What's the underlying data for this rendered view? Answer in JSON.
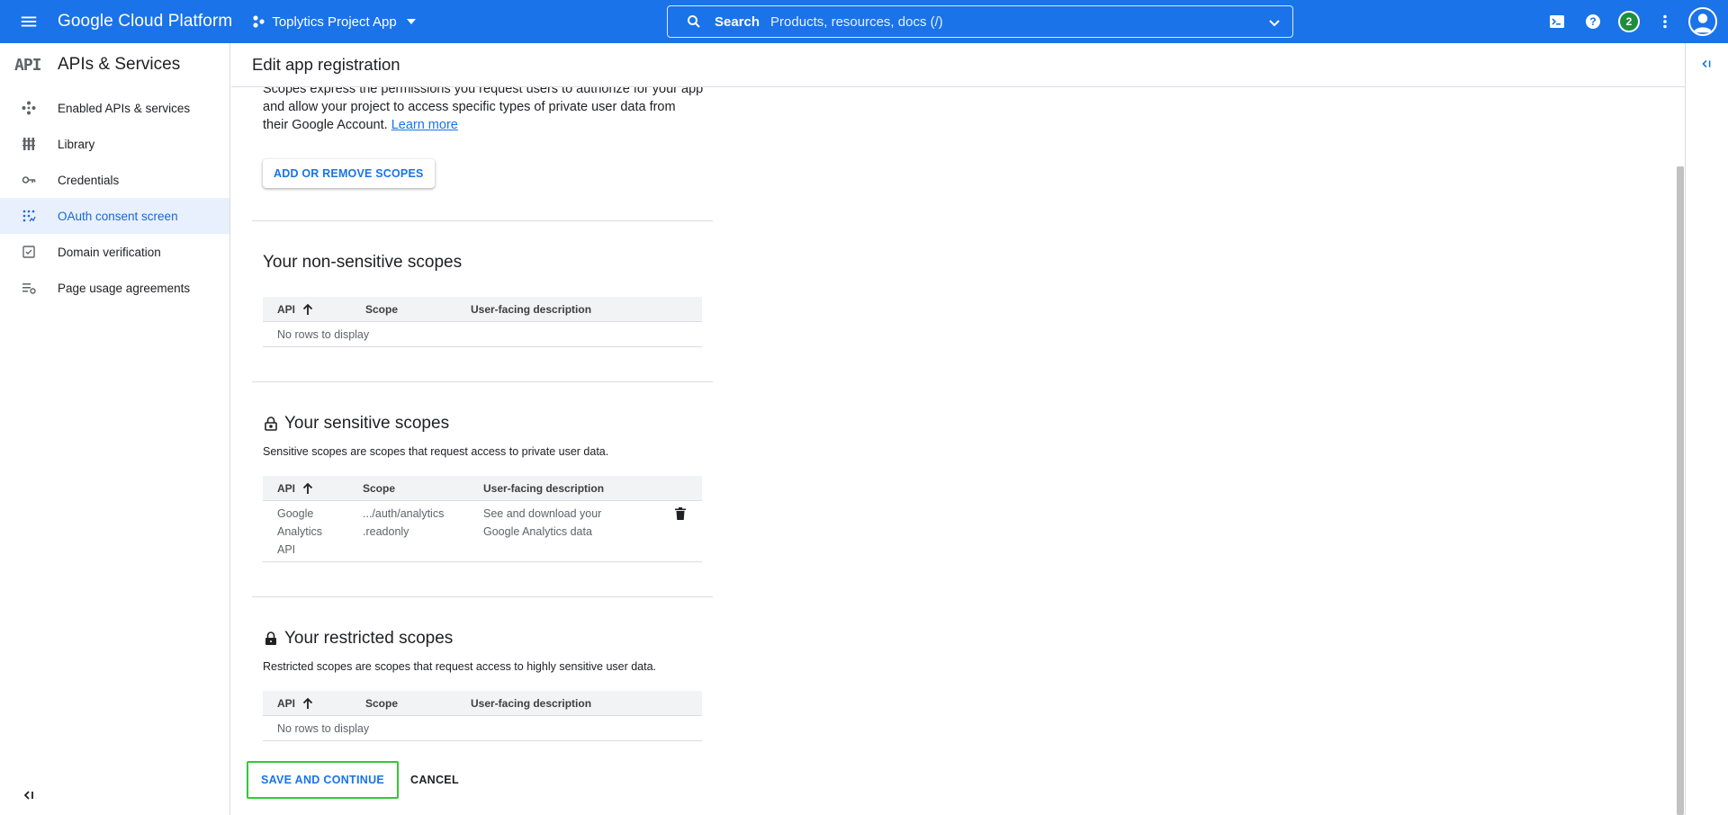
{
  "topbar": {
    "brand": "Google Cloud Platform",
    "project": "Toplytics Project App",
    "search_label": "Search",
    "search_placeholder": "Products, resources, docs (/)",
    "notification_count": "2"
  },
  "sidebar": {
    "logo": "API",
    "title": "APIs & Services",
    "items": [
      {
        "label": "Enabled APIs & services"
      },
      {
        "label": "Library"
      },
      {
        "label": "Credentials"
      },
      {
        "label": "OAuth consent screen"
      },
      {
        "label": "Domain verification"
      },
      {
        "label": "Page usage agreements"
      }
    ]
  },
  "page": {
    "title": "Edit app registration",
    "intro_text": "Scopes express the permissions you request users to authorize for your app and allow your project to access specific types of private user data from their Google Account.",
    "learn_more": "Learn more",
    "add_remove_button": "ADD OR REMOVE SCOPES"
  },
  "non_sensitive": {
    "title": "Your non-sensitive scopes",
    "columns": [
      "API",
      "Scope",
      "User-facing description"
    ],
    "empty": "No rows to display"
  },
  "sensitive": {
    "title": "Your sensitive scopes",
    "description": "Sensitive scopes are scopes that request access to private user data.",
    "columns": [
      "API",
      "Scope",
      "User-facing description"
    ],
    "rows": [
      {
        "api": [
          "Google",
          "Analytics",
          "API"
        ],
        "scope": [
          ".../auth/analytics",
          ".readonly"
        ],
        "desc": [
          "See and download your",
          "Google Analytics data"
        ]
      }
    ]
  },
  "restricted": {
    "title": "Your restricted scopes",
    "description": "Restricted scopes are scopes that request access to highly sensitive user data.",
    "columns": [
      "API",
      "Scope",
      "User-facing description"
    ],
    "empty": "No rows to display"
  },
  "actions": {
    "save": "SAVE AND CONTINUE",
    "cancel": "CANCEL"
  },
  "colors": {
    "brand_blue": "#1a73e8",
    "highlight_green": "#34c934",
    "badge_green": "#1e8e3e"
  }
}
